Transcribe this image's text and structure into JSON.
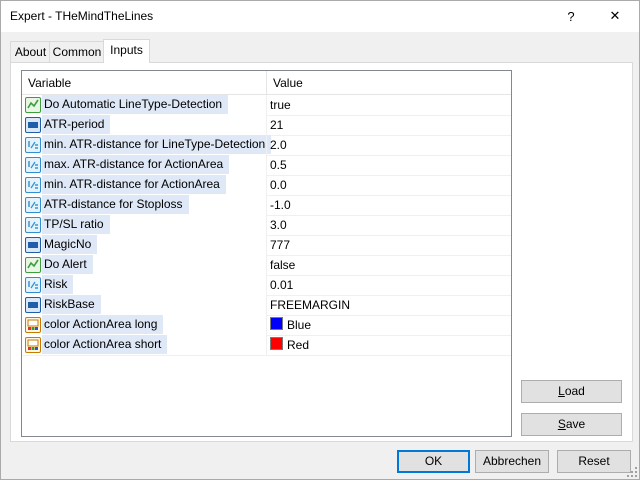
{
  "window": {
    "title": "Expert - THeMindTheLines",
    "help_glyph": "?",
    "close_glyph": "✕"
  },
  "tabs": [
    {
      "label": "About",
      "active": false
    },
    {
      "label": "Common",
      "active": false
    },
    {
      "label": "Inputs",
      "active": true
    }
  ],
  "table": {
    "columns": [
      "Variable",
      "Value"
    ],
    "rows": [
      {
        "icon": "bool-icon",
        "name": "Do Automatic LineType-Detection",
        "value": "true"
      },
      {
        "icon": "int-icon",
        "name": "ATR-period",
        "value": "21"
      },
      {
        "icon": "double-icon",
        "name": "min. ATR-distance for LineType-Detection",
        "value": "2.0"
      },
      {
        "icon": "double-icon",
        "name": "max. ATR-distance for ActionArea",
        "value": "0.5"
      },
      {
        "icon": "double-icon",
        "name": "min. ATR-distance for ActionArea",
        "value": "0.0"
      },
      {
        "icon": "double-icon",
        "name": "ATR-distance for Stoploss",
        "value": "-1.0"
      },
      {
        "icon": "double-icon",
        "name": "TP/SL ratio",
        "value": "3.0"
      },
      {
        "icon": "int-icon",
        "name": "MagicNo",
        "value": "777"
      },
      {
        "icon": "bool-icon",
        "name": "Do Alert",
        "value": "false"
      },
      {
        "icon": "double-icon",
        "name": "Risk",
        "value": "0.01"
      },
      {
        "icon": "int-icon",
        "name": "RiskBase",
        "value": "FREEMARGIN"
      },
      {
        "icon": "color-icon",
        "name": "color ActionArea long",
        "value": "Blue",
        "swatch": "#0000ff"
      },
      {
        "icon": "color-icon",
        "name": "color ActionArea short",
        "value": "Red",
        "swatch": "#ff0000"
      }
    ]
  },
  "side_buttons": {
    "load_mnemonic": "L",
    "load_rest": "oad",
    "save_mnemonic": "S",
    "save_rest": "ave"
  },
  "footer_buttons": {
    "ok": "OK",
    "cancel": "Abbrechen",
    "reset": "Reset"
  },
  "colors": {
    "selection_bg": "#dfe8f6",
    "default_button_border": "#0078d7",
    "icon_int_bg": "#1f5fa8",
    "icon_double_bg": "#2f8fd0",
    "icon_bool_bg": "#3aa03a"
  }
}
